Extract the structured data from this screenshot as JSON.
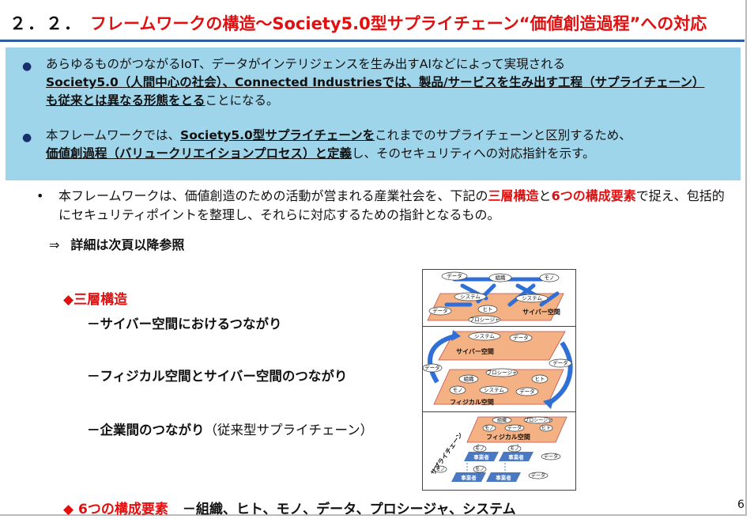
{
  "title": {
    "number": "２．２．",
    "text": "フレームワークの構造～Society5.0型サプライチェーン“価値創造過程”への対応"
  },
  "box": {
    "bullet1": {
      "t1": "あらゆるものがつながるIoT、データがインテリジェンスを生み出すAIなどによって実現される",
      "bold": "Society5.0（人間中心の社会）、Connected Industriesでは、製品/サービスを生み出す工程（サプライチェーン） も従来とは異なる形態をとる",
      "t2": "ことになる。"
    },
    "bullet2": {
      "t1": "本フレームワークでは、",
      "bold1": "Society5.0型サプライチェーンを",
      "t2": "これまでのサプライチェーンと区別するため、",
      "bold2": "価値創過程（バリュークリエイションプロセス）と定義",
      "t3": "し、そのセキュリティへの対応指針を示す。"
    }
  },
  "sub": {
    "t1": "本フレームワークは、価値創造のための活動が営まれる産業社会を、下記の",
    "red1": "三層構造",
    "t2": "と",
    "red2": "6つの構成要素",
    "t3": "で捉え、包括的にセキュリティポイントを整理し、それらに対応するための指針となるもの。"
  },
  "reference": {
    "arrow": "⇒",
    "text": "詳細は次頁以降参照"
  },
  "layers": {
    "heading": "◆三層構造",
    "items": [
      {
        "label": "－サイバー空間におけるつながり",
        "note": ""
      },
      {
        "label": "－フィジカル空間とサイバー空間のつながり",
        "note": ""
      },
      {
        "label": "－企業間のつながり",
        "note": "（従来型サプライチェーン）"
      }
    ]
  },
  "elements": {
    "heading": "◆ 6つの構成要素",
    "text": "－組織、ヒト、モノ、データ、プロシージャ、システム"
  },
  "diagrams": {
    "d1": {
      "tags": [
        "データ",
        "組織",
        "モノ",
        "システム",
        "システム",
        "データ",
        "ヒト",
        "サイバー空間",
        "プロシージャ"
      ]
    },
    "d2": {
      "cyber": "サイバー空間",
      "physical": "フィジカル空間",
      "tags": [
        "システム",
        "データ",
        "データ",
        "データ",
        "プロシージャ",
        "組織",
        "ヒト",
        "モノ",
        "システム",
        "データ"
      ]
    },
    "d3": {
      "vertical": "サプライチェーン",
      "physical": "フィジカル空間",
      "tags": [
        "組織",
        "プロシージャ",
        "モノ",
        "データ",
        "ヒト",
        "データ",
        "モノ",
        "事業者",
        "モノ",
        "事業者",
        "データ",
        "モノ",
        "事業者",
        "モノ",
        "事業者",
        "データ"
      ]
    }
  },
  "page_number": "6",
  "colors": {
    "title_red": "#e01010",
    "box_blue": "#9fd5ea",
    "rule_blue": "#2d5fa0",
    "plane_orange": "#f4b183",
    "arrow_blue": "#2f6fd6",
    "bar_blue": "#4a78c2"
  }
}
